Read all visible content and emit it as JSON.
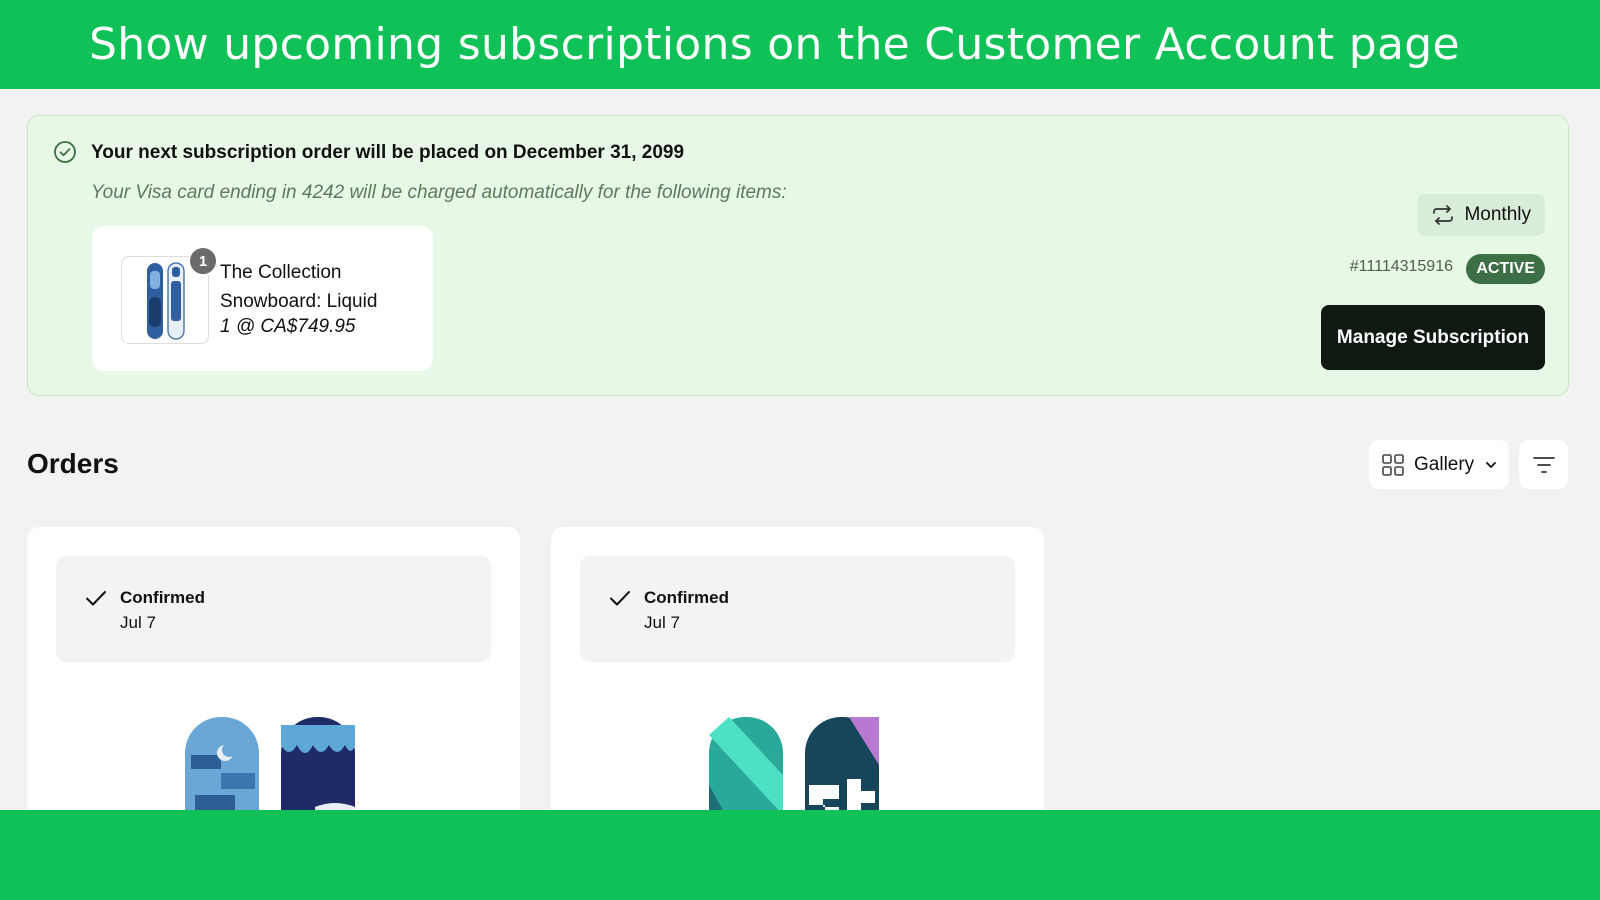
{
  "banner": {
    "title": "Show upcoming subscriptions on the Customer Account page"
  },
  "subscription": {
    "heading": "Your next subscription order will be placed on December 31, 2099",
    "note": "Your Visa card ending in 4242 will be charged automatically for the following items:",
    "item": {
      "quantity_badge": "1",
      "name": "The Collection Snowboard: Liquid",
      "price_line": "1 @ CA$749.95"
    },
    "frequency": "Monthly",
    "order_number": "#11114315916",
    "status": "ACTIVE",
    "manage_label": "Manage Subscription",
    "colors": {
      "card_bg": "#e7f9e6",
      "status_bg": "#3d6f44",
      "button_bg": "#0e1912"
    }
  },
  "orders": {
    "title": "Orders",
    "view_selector": {
      "selected": "Gallery"
    },
    "cards": [
      {
        "status": "Confirmed",
        "date": "Jul 7"
      },
      {
        "status": "Confirmed",
        "date": "Jul 7"
      }
    ]
  },
  "icons": {
    "check_circle": "check-circle-icon",
    "repeat": "repeat-icon",
    "grid": "grid-icon",
    "chevron": "chevron-down-icon",
    "filter": "filter-icon",
    "check": "check-icon"
  },
  "theme": {
    "banner_green": "#10c157",
    "page_bg": "#f2f2f2"
  }
}
